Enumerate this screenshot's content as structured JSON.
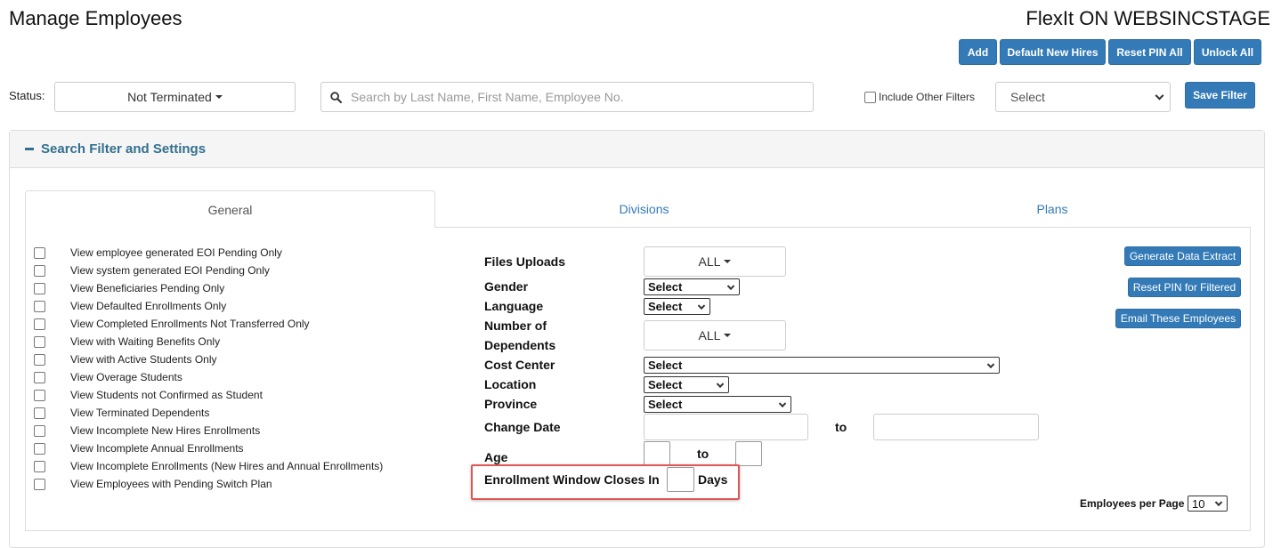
{
  "header": {
    "page_title": "Manage Employees",
    "app_title": "FlexIt ON WEBSINCSTAGE"
  },
  "top_buttons": [
    "Add",
    "Default New Hires",
    "Reset PIN All",
    "Unlock All"
  ],
  "filter_bar": {
    "status_label": "Status:",
    "status_value": "Not Terminated",
    "search_placeholder": "Search by Last Name, First Name, Employee No.",
    "include_other_filters": "Include Other Filters",
    "filter_select": "Select",
    "save_filter": "Save Filter"
  },
  "panel": {
    "title": "Search Filter and Settings",
    "tabs": [
      "General",
      "Divisions",
      "Plans"
    ],
    "active_tab": "General"
  },
  "checkbox_options": [
    "View employee generated EOI Pending Only",
    "View system generated EOI Pending Only",
    "View Beneficiaries Pending Only",
    "View Defaulted Enrollments Only",
    "View Completed Enrollments Not Transferred Only",
    "View with Waiting Benefits Only",
    "View with Active Students Only",
    "View Overage Students",
    "View Students not Confirmed as Student",
    "View Terminated Dependents",
    "View Incomplete New Hires Enrollments",
    "View Incomplete Annual Enrollments",
    "View Incomplete Enrollments (New Hires and Annual Enrollments)",
    "View Employees with Pending Switch Plan"
  ],
  "fields": {
    "files_uploads": {
      "label": "Files Uploads",
      "value": "ALL"
    },
    "gender": {
      "label": "Gender",
      "value": "Select"
    },
    "language": {
      "label": "Language",
      "value": "Select"
    },
    "dependents": {
      "label_line1": "Number of",
      "label_line2": "Dependents",
      "value": "ALL"
    },
    "cost_center": {
      "label": "Cost Center",
      "value": "Select"
    },
    "location": {
      "label": "Location",
      "value": "Select"
    },
    "province": {
      "label": "Province",
      "value": "Select"
    },
    "change_date": {
      "label": "Change Date",
      "to": "to"
    },
    "age": {
      "label": "Age",
      "to": "to"
    },
    "enrollment_window": {
      "label": "Enrollment Window Closes In",
      "suffix": "Days"
    }
  },
  "side_buttons": [
    "Generate Data Extract",
    "Reset PIN for Filtered",
    "Email These Employees"
  ],
  "pagination": {
    "label": "Employees per Page",
    "value": "10"
  },
  "colors": {
    "primary_button": "#337ab7",
    "link": "#337ab7",
    "panel_title": "#31708f",
    "highlight": "#e05656"
  }
}
